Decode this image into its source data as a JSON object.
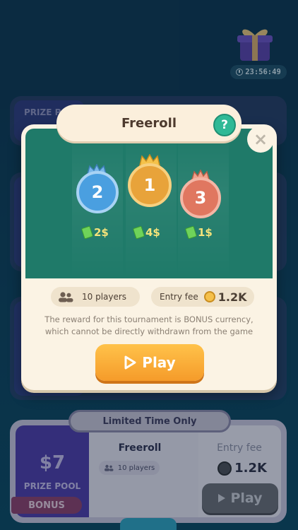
{
  "timer": {
    "value": "23:56:49"
  },
  "background_cards": {
    "card1_label": "PRIZE P"
  },
  "modal": {
    "title": "Freeroll",
    "help_label": "?",
    "close_label": "×",
    "medals": [
      {
        "rank": "2",
        "prize": "2$",
        "color": "#4a9fe0"
      },
      {
        "rank": "1",
        "prize": "4$",
        "color": "#e8a33a"
      },
      {
        "rank": "3",
        "prize": "1$",
        "color": "#e07760"
      }
    ],
    "players_label": "10 players",
    "entry_fee_label": "Entry fee",
    "entry_fee_value": "1.2K",
    "notice_line1": "The reward for this tournament is BONUS currency,",
    "notice_line2": "which cannot be directly withdrawn from the game",
    "play_label": "Play"
  },
  "bottom_card": {
    "banner": "Limited Time Only",
    "prize_amount": "$7",
    "prize_label": "PRIZE POOL",
    "bonus_label": "BONUS",
    "title": "Freeroll",
    "players_label": "10 players",
    "entry_fee_label": "Entry fee",
    "entry_fee_value": "1.2K",
    "play_label": "Play"
  },
  "colors": {
    "accent_green": "#1f7a69",
    "play_orange": "#f59b2a",
    "modal_cream": "#fbf3e4"
  }
}
